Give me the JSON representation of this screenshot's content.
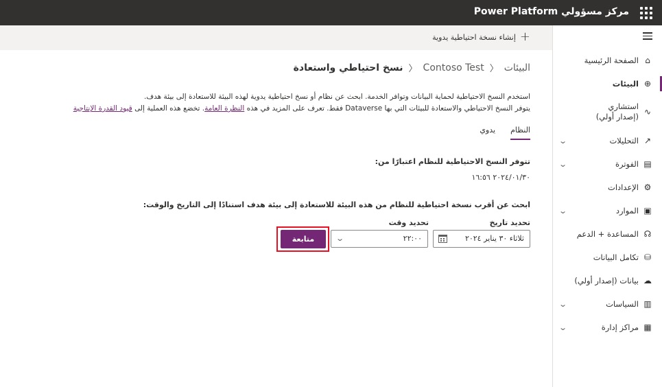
{
  "app": {
    "title": "مركز مسؤولي Power Platform"
  },
  "sidebar": {
    "items": [
      {
        "label": "الصفحة الرئيسية",
        "icon": "home-icon"
      },
      {
        "label": "البيئات",
        "icon": "globe-icon",
        "active": true
      },
      {
        "label": "استشاري (إصدار أولي)",
        "icon": "pulse-icon"
      },
      {
        "label": "التحليلات",
        "icon": "chart-icon",
        "expandable": true
      },
      {
        "label": "الفوترة",
        "icon": "billing-icon",
        "expandable": true
      },
      {
        "label": "الإعدادات",
        "icon": "gear-icon"
      },
      {
        "label": "الموارد",
        "icon": "resources-icon",
        "expandable": true
      },
      {
        "label": "المساعدة + الدعم",
        "icon": "headset-icon"
      },
      {
        "label": "تكامل البيانات",
        "icon": "data-integration-icon"
      },
      {
        "label": "بيانات (إصدار أولي)",
        "icon": "data-preview-icon"
      },
      {
        "label": "السياسات",
        "icon": "policies-icon",
        "expandable": true
      },
      {
        "label": "مراكز إدارة",
        "icon": "admin-centers-icon",
        "expandable": true
      }
    ]
  },
  "commandbar": {
    "create_backup": "إنشاء نسخة احتياطية يدوية"
  },
  "breadcrumb": {
    "env": "البيئات",
    "name": "Contoso Test",
    "current": "نسخ احتياطي واستعادة"
  },
  "description": {
    "line1": "استخدم النسخ الاحتياطية لحماية البيانات وتوافر الخدمة. ابحث عن نظام أو نسخ احتياطية يدوية لهذه البيئة للاستعادة إلى بيئة هدف.",
    "line2_pre": "يتوفر النسخ الاحتياطي والاستعادة للبيئات التي بها Dataverse فقط. تعرف على المزيد في هذه",
    "link1": "النظرة العامة",
    "line2_mid": ". تخضع هذه العملية إلى",
    "link2": "قيود القدرة الإنتاجية"
  },
  "tabs": {
    "system": "النظام",
    "manual": "يدوي"
  },
  "availability": {
    "title": "تتوفر النسخ الاحتياطية للنظام اعتبارًا من:",
    "date": "٢٠٢٤/٠١/٣٠ ١٦:٥٦"
  },
  "find": {
    "title": "ابحث عن أقرب نسخة احتياطية للنظام من هذه البيئة للاستعادة إلى بيئة هدف استنادًا إلى التاريخ والوقت:",
    "date_label": "تحديد تاريخ",
    "time_label": "تحديد وقت",
    "date_value": "ثلاثاء ٣٠ يناير ٢٠٢٤",
    "time_value": "٢٢:٠٠",
    "continue": "متابعة"
  },
  "colors": {
    "accent": "#742774",
    "topbar": "#323130",
    "highlight": "#e81123"
  }
}
